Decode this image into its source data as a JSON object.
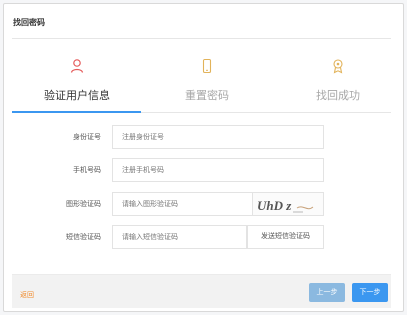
{
  "dialog": {
    "title": "找回密码"
  },
  "steps": [
    {
      "label": "验证用户信息",
      "icon": "user-icon",
      "state": "active"
    },
    {
      "label": "重置密码",
      "icon": "phone-icon",
      "state": "inactive"
    },
    {
      "label": "找回成功",
      "icon": "medal-icon",
      "state": "inactive"
    }
  ],
  "form": {
    "id_card": {
      "label": "身份证号",
      "placeholder": "注册身份证号"
    },
    "phone": {
      "label": "手机号码",
      "placeholder": "注册手机号码"
    },
    "captcha": {
      "label": "图形验证码",
      "placeholder": "请输入图形验证码",
      "image_text": "UhD z"
    },
    "sms": {
      "label": "短信验证码",
      "placeholder": "请输入短信验证码",
      "button": "发送短信验证码"
    }
  },
  "footer": {
    "back": "返回",
    "prev": "上一步",
    "next": "下一步"
  },
  "colors": {
    "accent": "#3b97f0",
    "link": "#f08a2a",
    "step_active_icon": "#e45a5a",
    "step_inactive_icon": "#e2b35a"
  }
}
